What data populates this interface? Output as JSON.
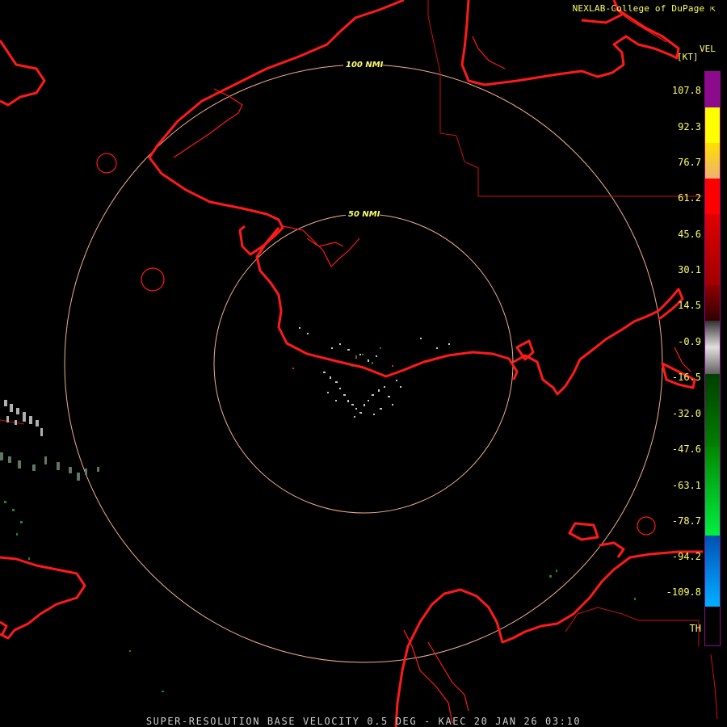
{
  "credit": "NEXLAB-College of DuPage",
  "credit_icon": "corner-arrow-icon",
  "scale": {
    "title": "VEL",
    "unit": "[KT]",
    "labels": [
      "107.8",
      "92.3",
      "76.7",
      "61.2",
      "45.6",
      "30.1",
      "14.5",
      "-0.9",
      "-16.5",
      "-32.0",
      "-47.6",
      "-63.1",
      "-78.7",
      "-94.2",
      "-109.8",
      "TH"
    ]
  },
  "rings": {
    "inner": "50 NMI",
    "outer": "100 NMI"
  },
  "footer": "SUPER-RESOLUTION BASE VELOCITY 0.5 DEG - KAEC 20 JAN 26 03:10",
  "colors": {
    "coast": "#ff1a1a",
    "ring": "#f0b090",
    "text": "#ffff66"
  }
}
